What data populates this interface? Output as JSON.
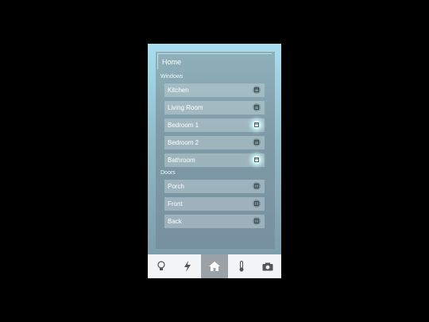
{
  "header": {
    "title": "Home"
  },
  "sections": [
    {
      "label": "Windows",
      "items": [
        {
          "label": "Kitchen",
          "icon": "window-icon",
          "active": false
        },
        {
          "label": "Living Room",
          "icon": "window-icon",
          "active": false
        },
        {
          "label": "Bedroom 1",
          "icon": "window-icon",
          "active": true
        },
        {
          "label": "Bedroom 2",
          "icon": "window-icon",
          "active": false
        },
        {
          "label": "Bathroom",
          "icon": "window-icon",
          "active": true
        }
      ]
    },
    {
      "label": "Doors",
      "items": [
        {
          "label": "Porch",
          "icon": "door-icon",
          "active": false
        },
        {
          "label": "Front",
          "icon": "door-icon",
          "active": false
        },
        {
          "label": "Back",
          "icon": "door-icon",
          "active": false
        }
      ]
    }
  ],
  "tabs": [
    {
      "name": "lightbulb-icon",
      "active": false
    },
    {
      "name": "lightning-icon",
      "active": false
    },
    {
      "name": "home-icon",
      "active": true
    },
    {
      "name": "thermometer-icon",
      "active": false
    },
    {
      "name": "camera-icon",
      "active": false
    }
  ],
  "colors": {
    "accent_glow": "#eaffff",
    "tab_active": "#9aa2a8",
    "tab_bg": "#f3f4f5"
  }
}
